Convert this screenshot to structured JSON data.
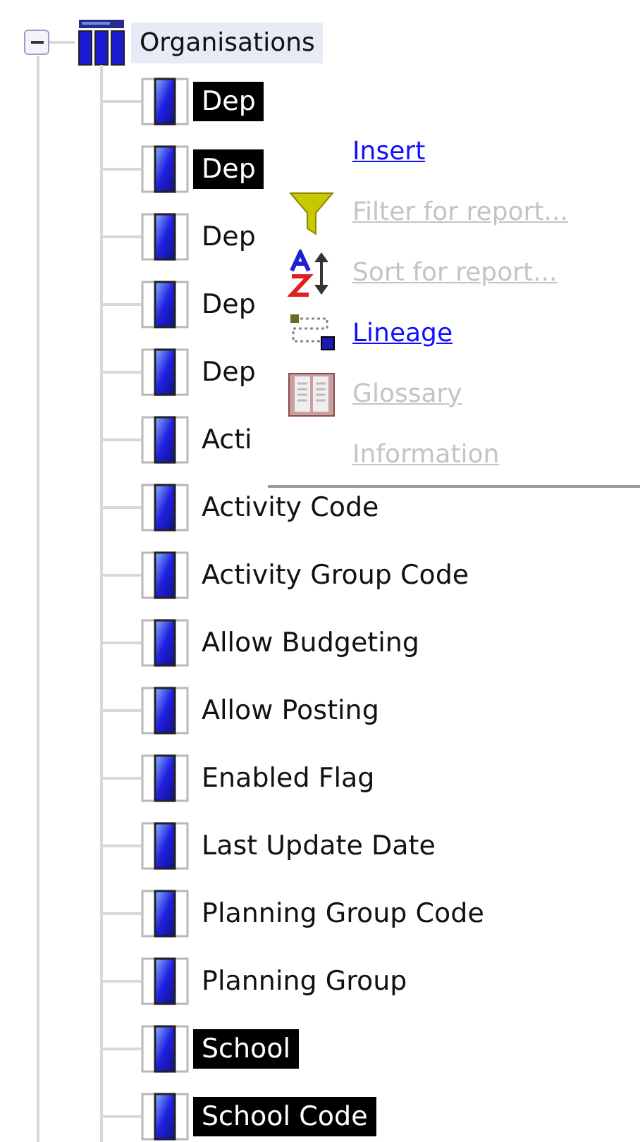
{
  "tree": {
    "root": {
      "label": "Organisations",
      "expanded": true,
      "highlighted": true
    },
    "children": [
      {
        "label": "Dep",
        "selected": true
      },
      {
        "label": "Dep",
        "selected": true
      },
      {
        "label": "Dep",
        "selected": false
      },
      {
        "label": "Dep",
        "selected": false
      },
      {
        "label": "Dep",
        "selected": false
      },
      {
        "label": "Acti",
        "selected": false
      },
      {
        "label": "Activity Code",
        "selected": false
      },
      {
        "label": "Activity Group Code",
        "selected": false
      },
      {
        "label": "Allow Budgeting",
        "selected": false
      },
      {
        "label": "Allow Posting",
        "selected": false
      },
      {
        "label": "Enabled Flag",
        "selected": false
      },
      {
        "label": "Last Update Date",
        "selected": false
      },
      {
        "label": "Planning Group Code",
        "selected": false
      },
      {
        "label": "Planning Group",
        "selected": false
      },
      {
        "label": "School",
        "selected": true
      },
      {
        "label": "School Code",
        "selected": true
      }
    ]
  },
  "context_menu": {
    "items": [
      {
        "label": "Insert",
        "disabled": false
      },
      {
        "label": "Filter for report...",
        "disabled": true,
        "kind": "filter"
      },
      {
        "label": "Sort for report...",
        "disabled": true,
        "kind": "sort"
      },
      {
        "label": "Lineage",
        "disabled": false,
        "kind": "lineage"
      },
      {
        "label": "Glossary",
        "disabled": true,
        "kind": "glossary"
      },
      {
        "label": "Information",
        "disabled": true
      }
    ]
  }
}
